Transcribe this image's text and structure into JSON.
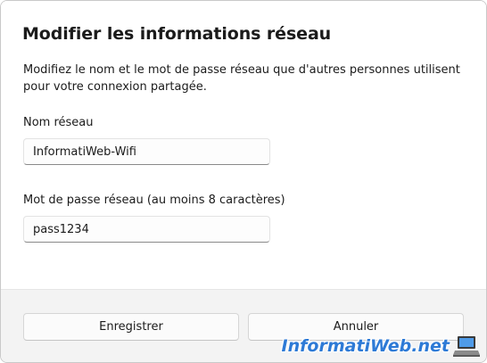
{
  "dialog": {
    "title": "Modifier les informations réseau",
    "description": "Modifiez le nom et le mot de passe réseau que d'autres personnes utilisent pour votre connexion partagée.",
    "network_name": {
      "label": "Nom réseau",
      "value": "InformatiWeb-Wifi"
    },
    "password": {
      "label": "Mot de passe réseau (au moins 8 caractères)",
      "value": "pass1234"
    },
    "buttons": {
      "save": "Enregistrer",
      "cancel": "Annuler"
    }
  },
  "watermark": {
    "text": "InformatiWeb.net",
    "icon": "laptop-icon",
    "color": "#2d7ad6"
  }
}
